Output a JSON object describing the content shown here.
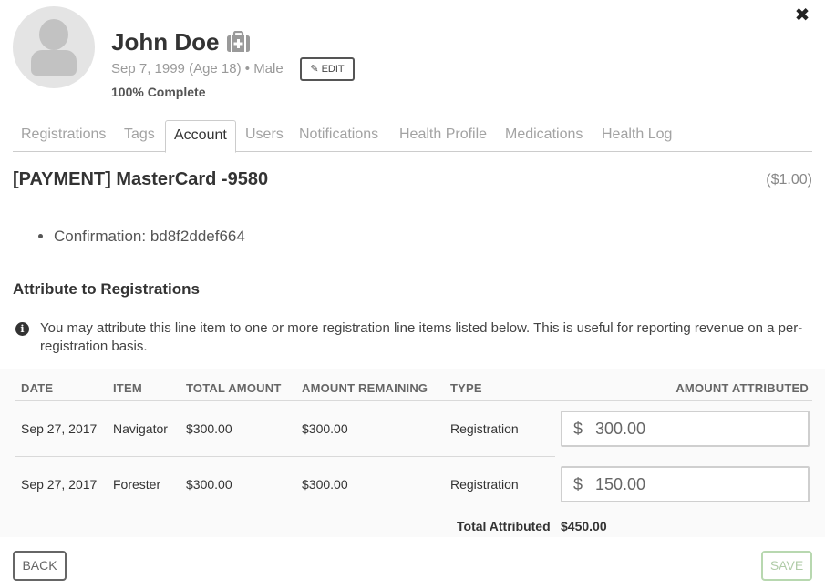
{
  "close": {
    "label": "✖"
  },
  "profile": {
    "name": "John Doe",
    "dob": "Sep 7, 1999 (Age 18) • Male",
    "edit_label": "EDIT",
    "completion": "100% Complete",
    "avatar_icon": "user-silhouette-icon",
    "medical_icon": "medkit-icon"
  },
  "tabs": [
    {
      "label": "Registrations",
      "active": false
    },
    {
      "label": "Tags",
      "active": false
    },
    {
      "label": "Account",
      "active": true
    },
    {
      "label": "Users",
      "active": false
    },
    {
      "label": "Notifications",
      "active": false
    },
    {
      "label": "Health Profile",
      "active": false
    },
    {
      "label": "Medications",
      "active": false
    },
    {
      "label": "Health Log",
      "active": false
    }
  ],
  "payment": {
    "title": "[PAYMENT] MasterCard -9580",
    "amount": "($1.00)",
    "confirmation": "Confirmation: bd8f2ddef664"
  },
  "attribute": {
    "heading": "Attribute to Registrations",
    "info": "You may attribute this line item to one or more registration line items listed below. This is useful for reporting revenue on a per-registration basis."
  },
  "table": {
    "headers": {
      "date": "DATE",
      "item": "ITEM",
      "total_amount": "TOTAL AMOUNT",
      "amount_remaining": "AMOUNT REMAINING",
      "type": "TYPE",
      "amount_attributed": "AMOUNT ATTRIBUTED"
    },
    "currency_symbol": "$",
    "rows": [
      {
        "date": "Sep 27, 2017",
        "item": "Navigator",
        "total_amount": "$300.00",
        "amount_remaining": "$300.00",
        "type": "Registration",
        "attributed": "300.00"
      },
      {
        "date": "Sep 27, 2017",
        "item": "Forester",
        "total_amount": "$300.00",
        "amount_remaining": "$300.00",
        "type": "Registration",
        "attributed": "150.00"
      }
    ],
    "total_label": "Total Attributed",
    "total_value": "$450.00"
  },
  "footer": {
    "back_label": "BACK",
    "save_label": "SAVE"
  },
  "colors": {
    "save_border": "#b8d8b0",
    "tab_inactive": "#a3a3a3"
  }
}
